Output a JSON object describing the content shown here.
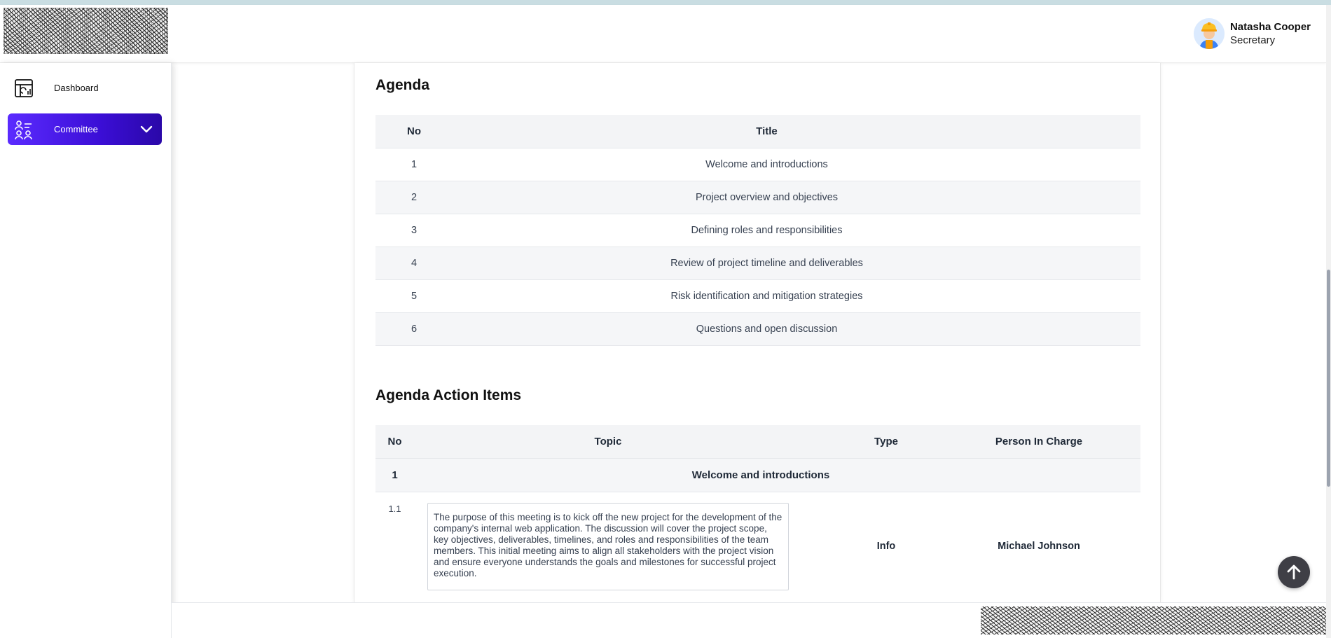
{
  "header": {
    "user_name": "Natasha Cooper",
    "user_role": "Secretary",
    "avatar_icon": "construction-worker-avatar",
    "logo": "brand-logo"
  },
  "sidebar": {
    "items": [
      {
        "label": "Dashboard",
        "icon": "dashboard-icon"
      },
      {
        "label": "Committee",
        "icon": "committee-icon",
        "active": true
      }
    ],
    "accent_color": "#4a1de8"
  },
  "agenda": {
    "title": "Agenda",
    "columns": {
      "no": "No",
      "title": "Title"
    },
    "rows": [
      {
        "no": "1",
        "title": "Welcome and introductions"
      },
      {
        "no": "2",
        "title": "Project overview and objectives"
      },
      {
        "no": "3",
        "title": "Defining roles and responsibilities"
      },
      {
        "no": "4",
        "title": "Review of project timeline and deliverables"
      },
      {
        "no": "5",
        "title": "Risk identification and mitigation strategies"
      },
      {
        "no": "6",
        "title": "Questions and open discussion"
      }
    ]
  },
  "action_items": {
    "title": "Agenda Action Items",
    "columns": {
      "no": "No",
      "topic": "Topic",
      "type": "Type",
      "person": "Person In Charge"
    },
    "groups": [
      {
        "no": "1",
        "title": "Welcome and introductions",
        "items": [
          {
            "no": "1.1",
            "topic": "The purpose of this meeting is to kick off the new project for the development of the company's internal web application. The discussion will cover the project scope, key objectives, deliverables, timelines, and roles and responsibilities of the team members. This initial meeting aims to align all stakeholders with the project vision and ensure everyone understands the goals and milestones for successful project execution.",
            "type": "Info",
            "person": "Michael Johnson"
          }
        ]
      }
    ]
  },
  "controls": {
    "scroll_top_icon": "arrow-up-icon"
  }
}
